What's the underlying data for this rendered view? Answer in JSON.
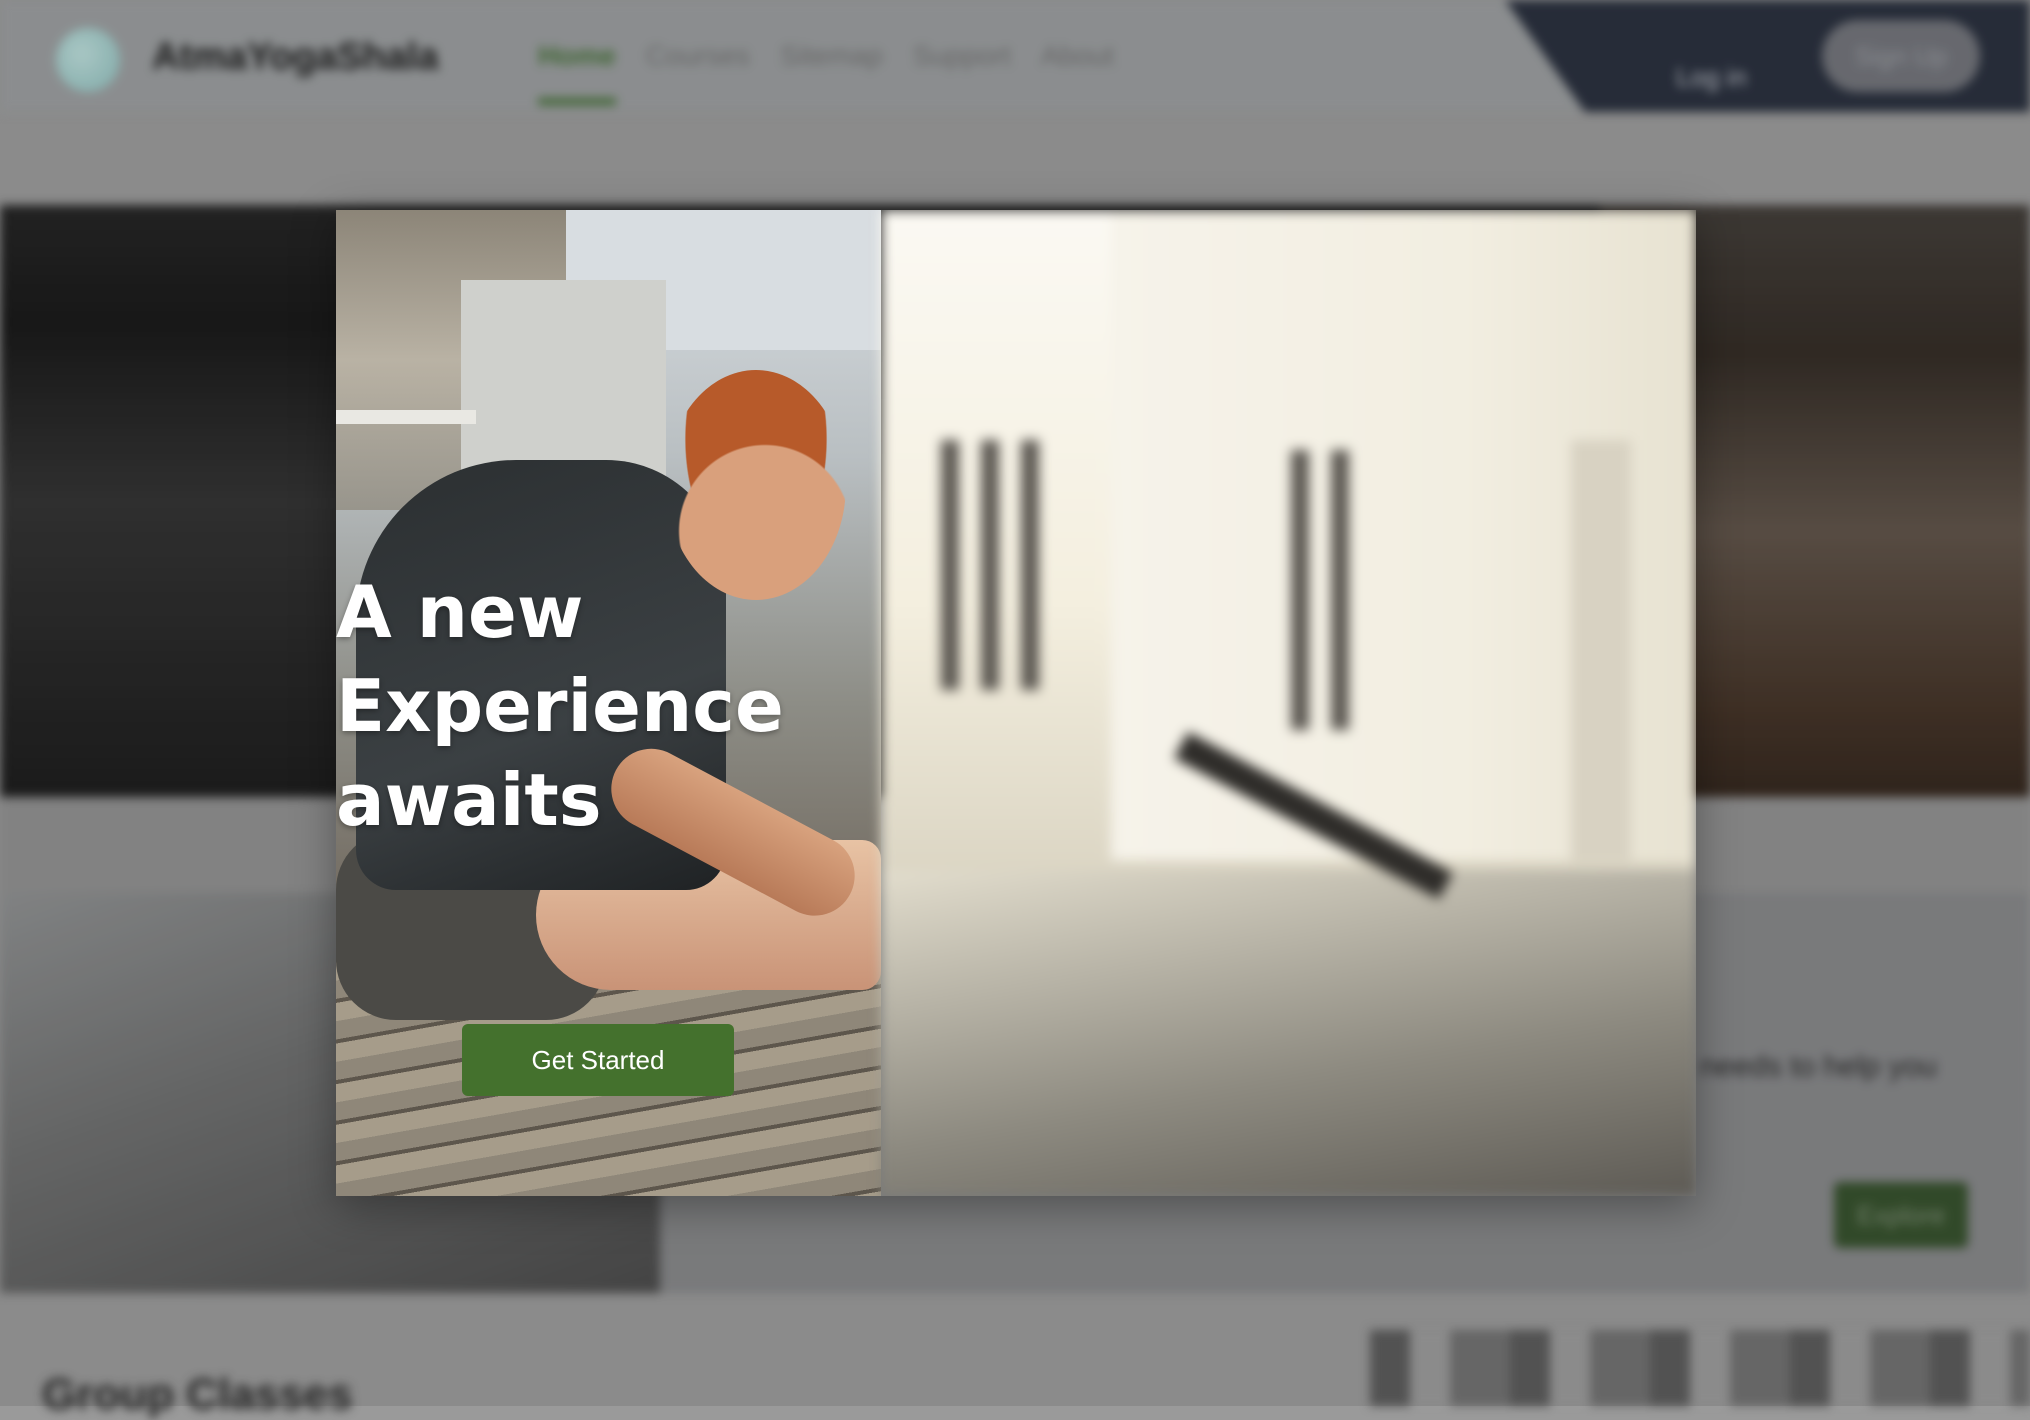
{
  "nav": {
    "brand": "AtmaYogaShala",
    "links": [
      "Home",
      "Courses",
      "Sitemap",
      "Support",
      "About"
    ],
    "active": "Home",
    "login": "Log in",
    "signup": "Sign Up"
  },
  "page": {
    "card_desc": "needs to help you",
    "explore": "Explore",
    "group_title": "Group Classes"
  },
  "modal": {
    "headline": [
      "A new",
      "Experience",
      "awaits"
    ],
    "cta": "Get Started"
  },
  "colors": {
    "accent_green": "#44712d",
    "nav_dark": "#1f2635"
  }
}
